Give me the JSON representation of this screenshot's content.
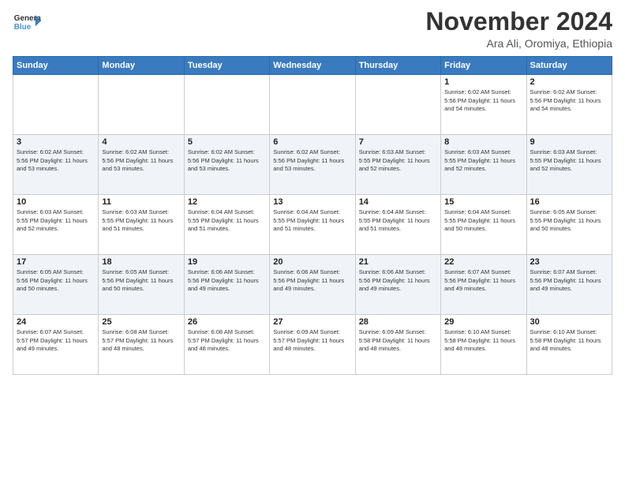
{
  "header": {
    "logo": {
      "line1": "General",
      "line2": "Blue",
      "icon": "▶"
    },
    "month_title": "November 2024",
    "location": "Ara Ali, Oromiya, Ethiopia"
  },
  "weekdays": [
    "Sunday",
    "Monday",
    "Tuesday",
    "Wednesday",
    "Thursday",
    "Friday",
    "Saturday"
  ],
  "weeks": [
    [
      {
        "day": "",
        "info": ""
      },
      {
        "day": "",
        "info": ""
      },
      {
        "day": "",
        "info": ""
      },
      {
        "day": "",
        "info": ""
      },
      {
        "day": "",
        "info": ""
      },
      {
        "day": "1",
        "info": "Sunrise: 6:02 AM\nSunset: 5:56 PM\nDaylight: 11 hours\nand 54 minutes."
      },
      {
        "day": "2",
        "info": "Sunrise: 6:02 AM\nSunset: 5:56 PM\nDaylight: 11 hours\nand 54 minutes."
      }
    ],
    [
      {
        "day": "3",
        "info": "Sunrise: 6:02 AM\nSunset: 5:56 PM\nDaylight: 11 hours\nand 53 minutes."
      },
      {
        "day": "4",
        "info": "Sunrise: 6:02 AM\nSunset: 5:56 PM\nDaylight: 11 hours\nand 53 minutes."
      },
      {
        "day": "5",
        "info": "Sunrise: 6:02 AM\nSunset: 5:56 PM\nDaylight: 11 hours\nand 53 minutes."
      },
      {
        "day": "6",
        "info": "Sunrise: 6:02 AM\nSunset: 5:56 PM\nDaylight: 11 hours\nand 53 minutes."
      },
      {
        "day": "7",
        "info": "Sunrise: 6:03 AM\nSunset: 5:55 PM\nDaylight: 11 hours\nand 52 minutes."
      },
      {
        "day": "8",
        "info": "Sunrise: 6:03 AM\nSunset: 5:55 PM\nDaylight: 11 hours\nand 52 minutes."
      },
      {
        "day": "9",
        "info": "Sunrise: 6:03 AM\nSunset: 5:55 PM\nDaylight: 11 hours\nand 52 minutes."
      }
    ],
    [
      {
        "day": "10",
        "info": "Sunrise: 6:03 AM\nSunset: 5:55 PM\nDaylight: 11 hours\nand 52 minutes."
      },
      {
        "day": "11",
        "info": "Sunrise: 6:03 AM\nSunset: 5:55 PM\nDaylight: 11 hours\nand 51 minutes."
      },
      {
        "day": "12",
        "info": "Sunrise: 6:04 AM\nSunset: 5:55 PM\nDaylight: 11 hours\nand 51 minutes."
      },
      {
        "day": "13",
        "info": "Sunrise: 6:04 AM\nSunset: 5:55 PM\nDaylight: 11 hours\nand 51 minutes."
      },
      {
        "day": "14",
        "info": "Sunrise: 6:04 AM\nSunset: 5:55 PM\nDaylight: 11 hours\nand 51 minutes."
      },
      {
        "day": "15",
        "info": "Sunrise: 6:04 AM\nSunset: 5:55 PM\nDaylight: 11 hours\nand 50 minutes."
      },
      {
        "day": "16",
        "info": "Sunrise: 6:05 AM\nSunset: 5:55 PM\nDaylight: 11 hours\nand 50 minutes."
      }
    ],
    [
      {
        "day": "17",
        "info": "Sunrise: 6:05 AM\nSunset: 5:56 PM\nDaylight: 11 hours\nand 50 minutes."
      },
      {
        "day": "18",
        "info": "Sunrise: 6:05 AM\nSunset: 5:56 PM\nDaylight: 11 hours\nand 50 minutes."
      },
      {
        "day": "19",
        "info": "Sunrise: 6:06 AM\nSunset: 5:56 PM\nDaylight: 11 hours\nand 49 minutes."
      },
      {
        "day": "20",
        "info": "Sunrise: 6:06 AM\nSunset: 5:56 PM\nDaylight: 11 hours\nand 49 minutes."
      },
      {
        "day": "21",
        "info": "Sunrise: 6:06 AM\nSunset: 5:56 PM\nDaylight: 11 hours\nand 49 minutes."
      },
      {
        "day": "22",
        "info": "Sunrise: 6:07 AM\nSunset: 5:56 PM\nDaylight: 11 hours\nand 49 minutes."
      },
      {
        "day": "23",
        "info": "Sunrise: 6:07 AM\nSunset: 5:56 PM\nDaylight: 11 hours\nand 49 minutes."
      }
    ],
    [
      {
        "day": "24",
        "info": "Sunrise: 6:07 AM\nSunset: 5:57 PM\nDaylight: 11 hours\nand 49 minutes."
      },
      {
        "day": "25",
        "info": "Sunrise: 6:08 AM\nSunset: 5:57 PM\nDaylight: 11 hours\nand 48 minutes."
      },
      {
        "day": "26",
        "info": "Sunrise: 6:08 AM\nSunset: 5:57 PM\nDaylight: 11 hours\nand 48 minutes."
      },
      {
        "day": "27",
        "info": "Sunrise: 6:09 AM\nSunset: 5:57 PM\nDaylight: 11 hours\nand 48 minutes."
      },
      {
        "day": "28",
        "info": "Sunrise: 6:09 AM\nSunset: 5:58 PM\nDaylight: 11 hours\nand 48 minutes."
      },
      {
        "day": "29",
        "info": "Sunrise: 6:10 AM\nSunset: 5:58 PM\nDaylight: 11 hours\nand 48 minutes."
      },
      {
        "day": "30",
        "info": "Sunrise: 6:10 AM\nSunset: 5:58 PM\nDaylight: 11 hours\nand 48 minutes."
      }
    ]
  ]
}
